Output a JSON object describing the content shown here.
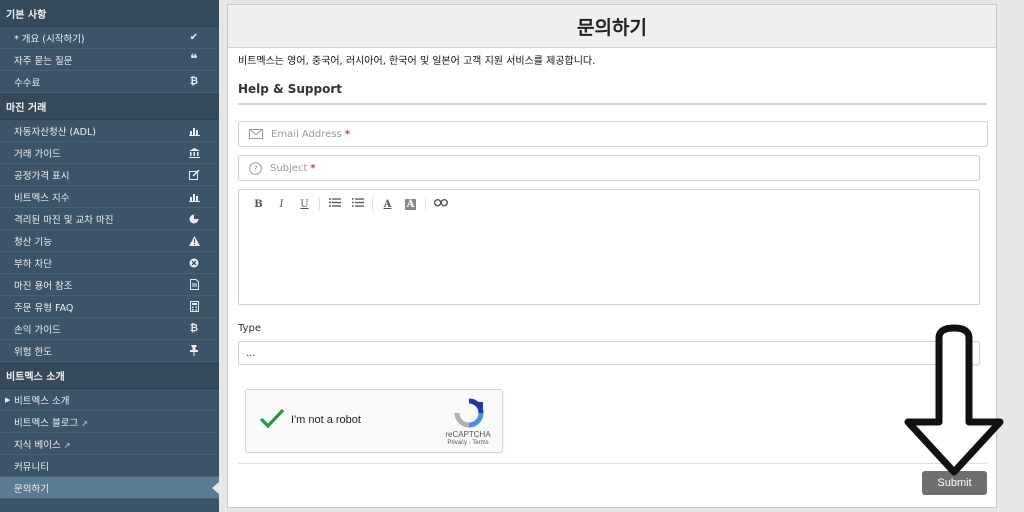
{
  "sidebar": {
    "sections": [
      {
        "title": "기본 사항",
        "items": [
          {
            "label": "* 개요 (시작하기)",
            "icon": "checkmark-icon"
          },
          {
            "label": "자주 묻는 질문",
            "icon": "quote-icon"
          },
          {
            "label": "수수료",
            "icon": "bitcoin-icon"
          }
        ]
      },
      {
        "title": "마진 거래",
        "items": [
          {
            "label": "자동자산청산 (ADL)",
            "icon": "bar-chart-icon"
          },
          {
            "label": "거래 가이드",
            "icon": "bank-icon"
          },
          {
            "label": "공정가격 표시",
            "icon": "edit-icon"
          },
          {
            "label": "비트멕스 지수",
            "icon": "bar-chart-icon"
          },
          {
            "label": "격리된 마진 및 교차 마진",
            "icon": "pie-chart-icon"
          },
          {
            "label": "청산 기능",
            "icon": "warning-icon"
          },
          {
            "label": "부하 차단",
            "icon": "close-circle-icon"
          },
          {
            "label": "마진 용어 참조",
            "icon": "document-icon"
          },
          {
            "label": "주문 유형 FAQ",
            "icon": "calculator-icon"
          },
          {
            "label": "손익 가이드",
            "icon": "bitcoin-icon"
          },
          {
            "label": "위험 한도",
            "icon": "pin-icon"
          }
        ]
      },
      {
        "title": "비트멕스 소개",
        "items": [
          {
            "label": "비트멕스 소개"
          },
          {
            "label": "비트멕스 블로그"
          },
          {
            "label": "지식 베이스"
          },
          {
            "label": "커뮤니티"
          },
          {
            "label": "문의하기"
          }
        ]
      }
    ]
  },
  "page": {
    "title": "문의하기",
    "intro": "비트멕스는 영어, 중국어, 러시아어, 한국어 및 일본어 고객 지원 서비스를 제공합니다.",
    "section_heading": "Help & Support"
  },
  "form": {
    "email_placeholder": "Email Address",
    "subject_placeholder": "Subject",
    "required_mark": "*",
    "toolbar": {
      "bold": "B",
      "italic": "I",
      "underline": "U",
      "font_color": "A",
      "bg_color": "A"
    },
    "type_label": "Type",
    "type_value": "...",
    "submit_label": "Submit"
  },
  "recaptcha": {
    "label": "I'm not a robot",
    "brand": "reCAPTCHA",
    "terms": "Privacy - Terms"
  }
}
